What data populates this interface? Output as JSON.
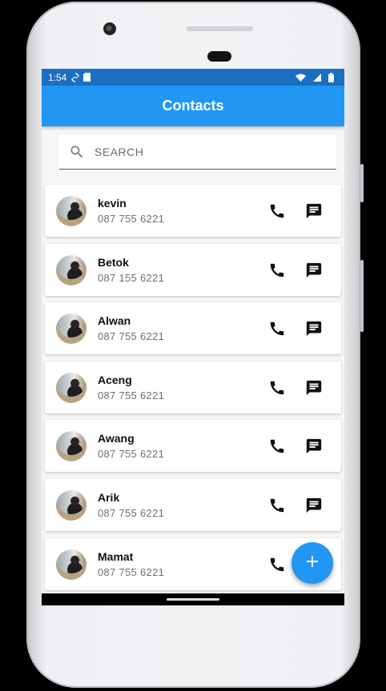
{
  "status_bar": {
    "time": "1:54"
  },
  "app_bar": {
    "title": "Contacts"
  },
  "search": {
    "placeholder": "SEARCH"
  },
  "contacts": [
    {
      "name": "kevin",
      "phone": "087 755 6221"
    },
    {
      "name": "Betok",
      "phone": "087 155 6221"
    },
    {
      "name": "Alwan",
      "phone": "087 755 6221"
    },
    {
      "name": "Aceng",
      "phone": "087 755 6221"
    },
    {
      "name": "Awang",
      "phone": "087 755 6221"
    },
    {
      "name": "Arik",
      "phone": "087 755 6221"
    },
    {
      "name": "Mamat",
      "phone": "087 755 6221"
    }
  ],
  "icons": {
    "search": "search-icon",
    "call": "phone-icon",
    "message": "message-icon",
    "add": "plus-icon"
  },
  "colors": {
    "app_bar": "#2196f3",
    "status_bar": "#1b6fc1",
    "fab": "#2196f3"
  }
}
